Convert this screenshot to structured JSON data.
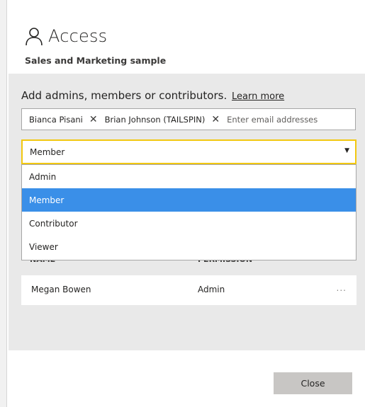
{
  "header": {
    "title": "Access",
    "title_icon": "person-icon",
    "subtitle": "Sales and Marketing sample"
  },
  "add_section": {
    "label": "Add admins, members or contributors.",
    "learn_more": "Learn more"
  },
  "email_field": {
    "chips": [
      {
        "label": "Bianca Pisani",
        "remove_icon": "close-icon"
      },
      {
        "label": "Brian Johnson (TAILSPIN)",
        "remove_icon": "close-icon"
      }
    ],
    "placeholder": "Enter email addresses"
  },
  "role_select": {
    "selected": "Member",
    "caret_icon": "caret-down-icon",
    "options": [
      {
        "label": "Admin",
        "selected": false
      },
      {
        "label": "Member",
        "selected": true
      },
      {
        "label": "Contributor",
        "selected": false
      },
      {
        "label": "Viewer",
        "selected": false
      }
    ]
  },
  "table": {
    "columns": [
      "NAME",
      "PERMISSION"
    ],
    "rows": [
      {
        "name": "Megan Bowen",
        "permission": "Admin",
        "more": "..."
      }
    ]
  },
  "footer": {
    "close_label": "Close"
  },
  "colors": {
    "panel_bg": "#e9e9e9",
    "focus_border": "#f2c811",
    "selected_option_bg": "#3a8fe8",
    "button_bg": "#c8c6c4"
  }
}
